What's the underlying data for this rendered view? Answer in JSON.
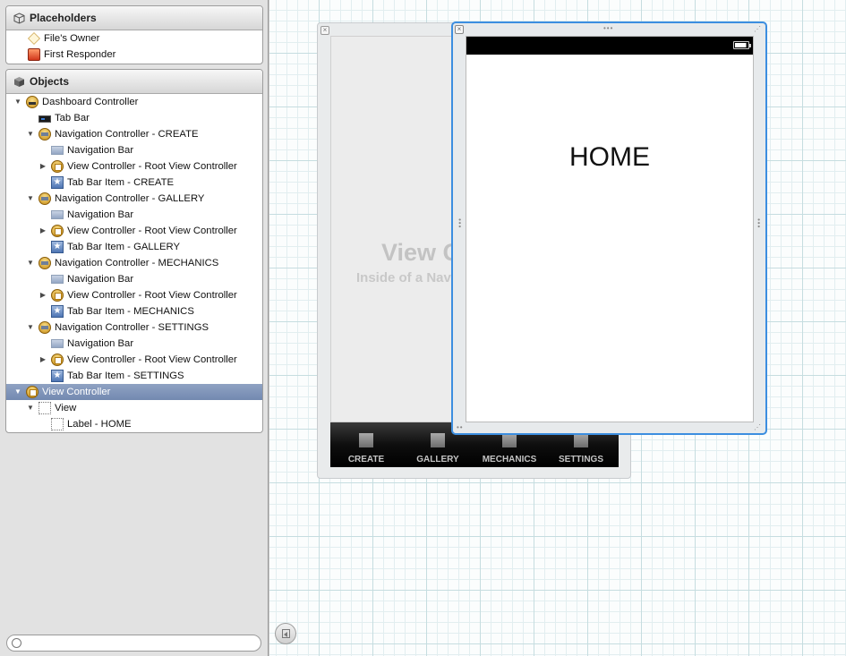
{
  "outline": {
    "placeholders": {
      "title": "Placeholders",
      "icon": "cube-outline-icon",
      "items": [
        {
          "label": "File's Owner",
          "icon": "files-owner-cube-icon"
        },
        {
          "label": "First Responder",
          "icon": "first-responder-cube-icon"
        }
      ]
    },
    "objects": {
      "title": "Objects",
      "icon": "cube-solid-icon",
      "items": [
        {
          "label": "Dashboard Controller",
          "level": 0,
          "disclosure": "expanded",
          "icon": "tab-bar-controller-icon",
          "selected": false
        },
        {
          "label": "Tab Bar",
          "level": 1,
          "disclosure": "none",
          "icon": "tab-bar-icon",
          "selected": false
        },
        {
          "label": "Navigation Controller - CREATE",
          "level": 1,
          "disclosure": "expanded",
          "icon": "navigation-controller-icon",
          "selected": false
        },
        {
          "label": "Navigation Bar",
          "level": 2,
          "disclosure": "none",
          "icon": "navigation-bar-icon",
          "selected": false
        },
        {
          "label": "View Controller - Root View Controller",
          "level": 2,
          "disclosure": "collapsed",
          "icon": "view-controller-icon",
          "selected": false
        },
        {
          "label": "Tab Bar Item - CREATE",
          "level": 2,
          "disclosure": "none",
          "icon": "tab-bar-item-icon",
          "selected": false
        },
        {
          "label": "Navigation Controller - GALLERY",
          "level": 1,
          "disclosure": "expanded",
          "icon": "navigation-controller-icon",
          "selected": false
        },
        {
          "label": "Navigation Bar",
          "level": 2,
          "disclosure": "none",
          "icon": "navigation-bar-icon",
          "selected": false
        },
        {
          "label": "View Controller - Root View Controller",
          "level": 2,
          "disclosure": "collapsed",
          "icon": "view-controller-icon",
          "selected": false
        },
        {
          "label": "Tab Bar Item - GALLERY",
          "level": 2,
          "disclosure": "none",
          "icon": "tab-bar-item-icon",
          "selected": false
        },
        {
          "label": "Navigation Controller - MECHANICS",
          "level": 1,
          "disclosure": "expanded",
          "icon": "navigation-controller-icon",
          "selected": false
        },
        {
          "label": "Navigation Bar",
          "level": 2,
          "disclosure": "none",
          "icon": "navigation-bar-icon",
          "selected": false
        },
        {
          "label": "View Controller - Root View Controller",
          "level": 2,
          "disclosure": "collapsed",
          "icon": "view-controller-icon",
          "selected": false
        },
        {
          "label": "Tab Bar Item - MECHANICS",
          "level": 2,
          "disclosure": "none",
          "icon": "tab-bar-item-icon",
          "selected": false
        },
        {
          "label": "Navigation Controller - SETTINGS",
          "level": 1,
          "disclosure": "expanded",
          "icon": "navigation-controller-icon",
          "selected": false
        },
        {
          "label": "Navigation Bar",
          "level": 2,
          "disclosure": "none",
          "icon": "navigation-bar-icon",
          "selected": false
        },
        {
          "label": "View Controller - Root View Controller",
          "level": 2,
          "disclosure": "collapsed",
          "icon": "view-controller-icon",
          "selected": false
        },
        {
          "label": "Tab Bar Item - SETTINGS",
          "level": 2,
          "disclosure": "none",
          "icon": "tab-bar-item-icon",
          "selected": false
        },
        {
          "label": "View Controller",
          "level": 0,
          "disclosure": "expanded",
          "icon": "view-controller-icon",
          "selected": true
        },
        {
          "label": "View",
          "level": 1,
          "disclosure": "expanded",
          "icon": "view-icon",
          "selected": false
        },
        {
          "label": "Label - HOME",
          "level": 2,
          "disclosure": "none",
          "icon": "label-icon",
          "selected": false
        }
      ]
    },
    "search": {
      "placeholder": "",
      "icon": "search-icon"
    }
  },
  "canvas": {
    "tab_scene": {
      "title_text": "View C",
      "subtitle_text": "Inside of a Navi",
      "tabs": [
        {
          "label": "CREATE"
        },
        {
          "label": "GALLERY"
        },
        {
          "label": "MECHANICS"
        },
        {
          "label": "SETTINGS"
        }
      ]
    },
    "home_scene": {
      "label": "HOME",
      "status_icon": "battery-icon"
    },
    "selection_color": "#3c8ee0"
  }
}
